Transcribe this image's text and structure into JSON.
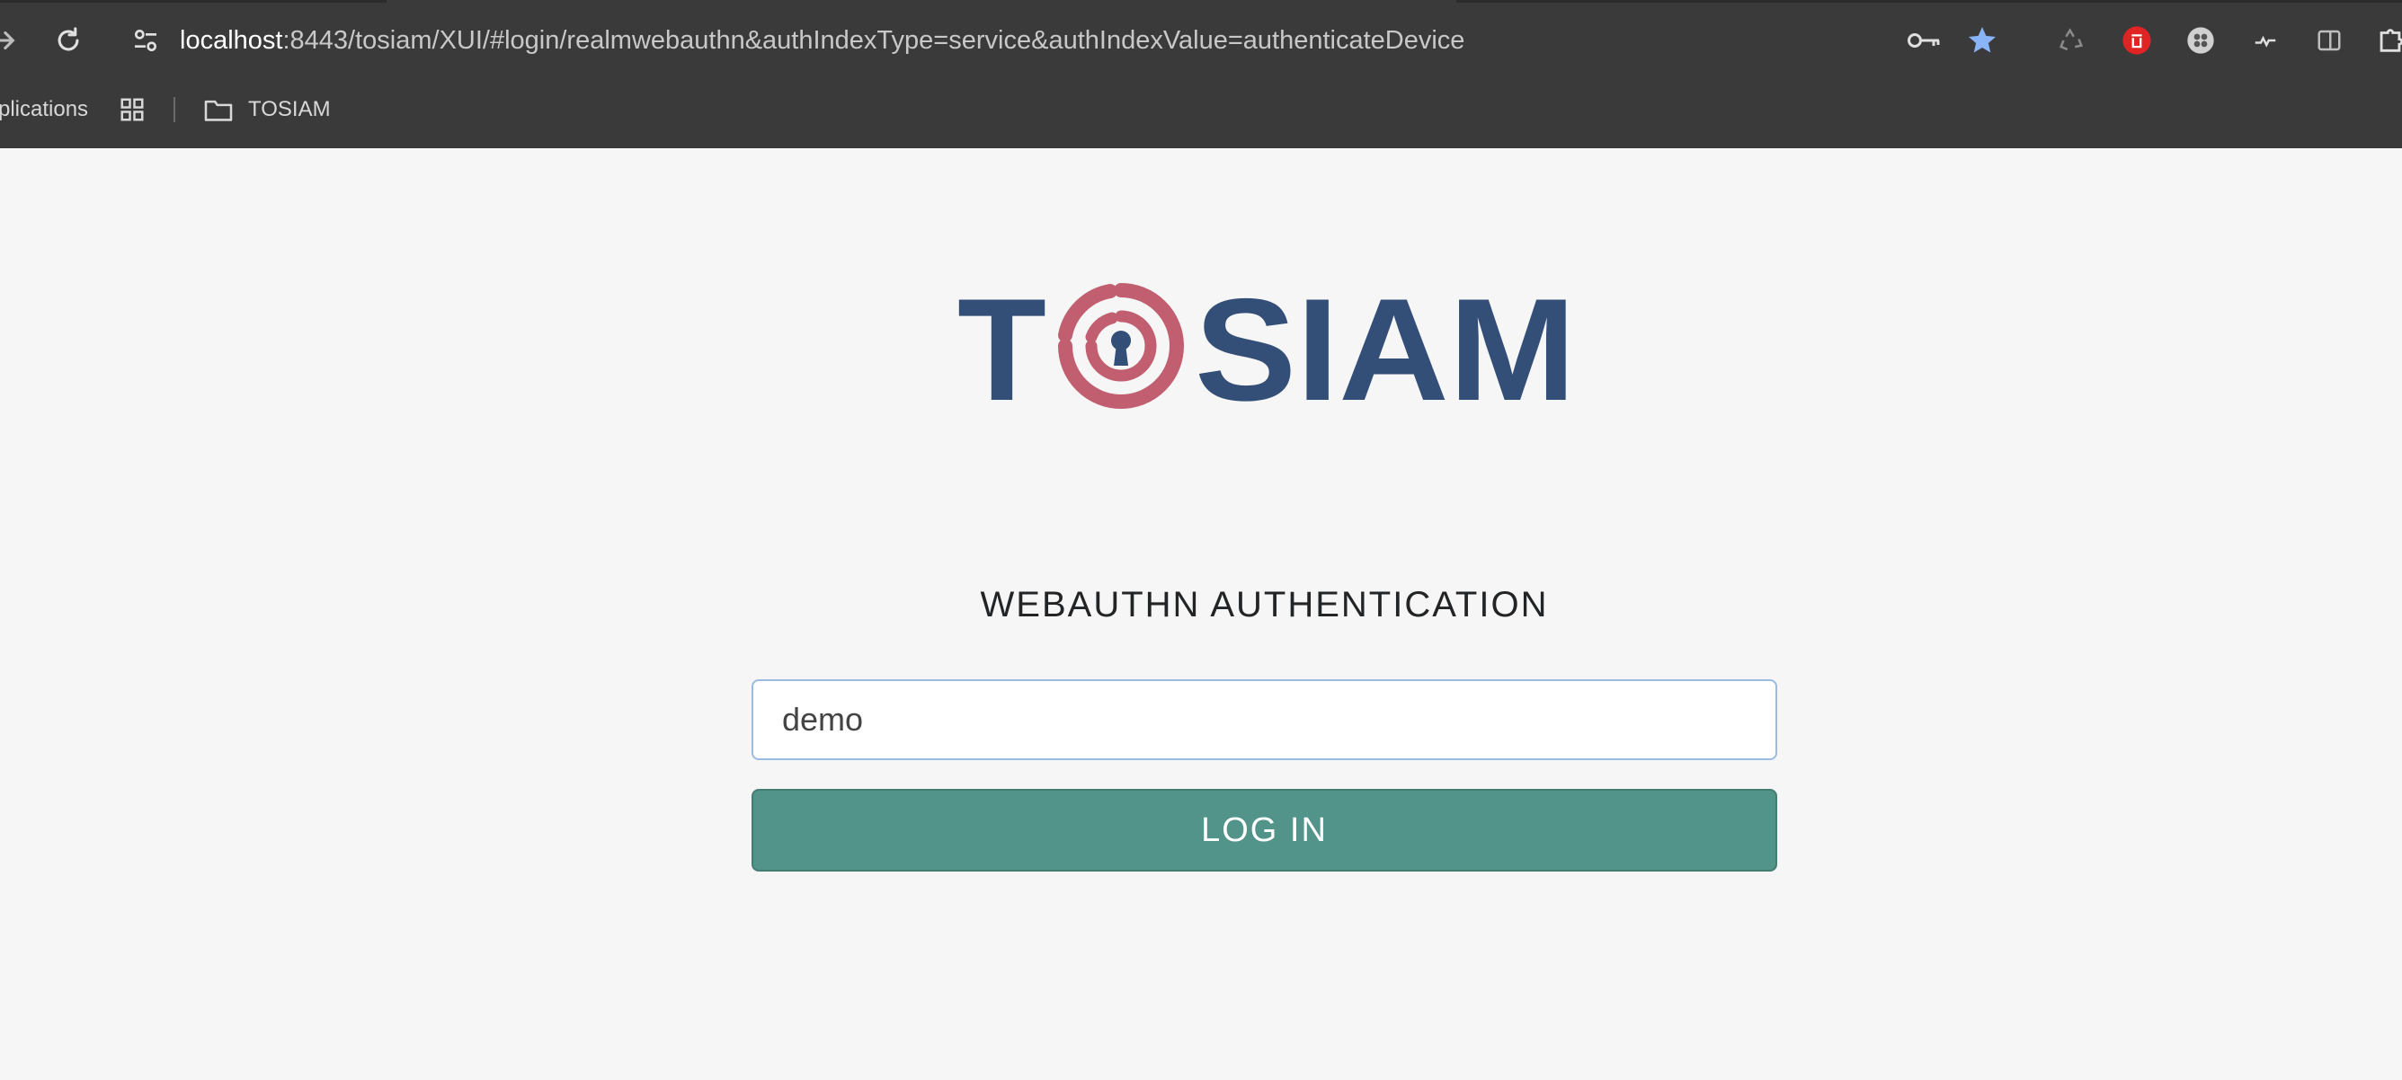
{
  "browser": {
    "url_host": "localhost",
    "url_rest": ":8443/tosiam/XUI/#login/realmwebauthn&authIndexType=service&authIndexValue=authenticateDevice",
    "bookmarks": [
      {
        "label": "plications",
        "icon": "apps-grid-icon"
      },
      {
        "label": "TOSIAM",
        "icon": "folder-icon"
      }
    ],
    "icons": [
      "back-icon",
      "reload-icon",
      "site-info-icon",
      "key-icon",
      "star-icon",
      "recycle-icon",
      "extension-red-icon",
      "extension-gray-icon",
      "extension-wave-icon",
      "side-panel-icon",
      "extensions-puzzle-icon"
    ],
    "star_color": "#8ab4f8"
  },
  "logo": {
    "letters_left": "T",
    "letters_right": "SIAM",
    "primary_color": "#344f77",
    "accent_color": "#c15e6f"
  },
  "login": {
    "heading": "WEBAUTHN AUTHENTICATION",
    "username_value": "demo",
    "button_label": "LOG IN",
    "button_color": "#52948a"
  }
}
